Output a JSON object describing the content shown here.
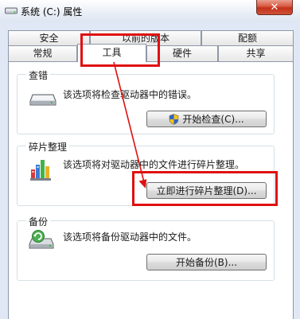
{
  "window": {
    "title": "系统 (C:) 属性",
    "close_symbol": "✕"
  },
  "tabs": {
    "row1": [
      "安全",
      "以前的版本",
      "配额"
    ],
    "row2": [
      "常规",
      "工具",
      "硬件",
      "共享"
    ],
    "active": "工具"
  },
  "groups": {
    "check": {
      "title": "查错",
      "description": "该选项将检查驱动器中的错误。",
      "button": "开始检查(C)..."
    },
    "defrag": {
      "title": "碎片整理",
      "description": "该选项将对驱动器中的文件进行碎片整理。",
      "button": "立即进行碎片整理(D)..."
    },
    "backup": {
      "title": "备份",
      "description": "该选项将备份驱动器中的文件。",
      "button": "开始备份(B)..."
    }
  },
  "colors": {
    "annotation": "#e01010",
    "window_frame": "#dfe8f4"
  }
}
